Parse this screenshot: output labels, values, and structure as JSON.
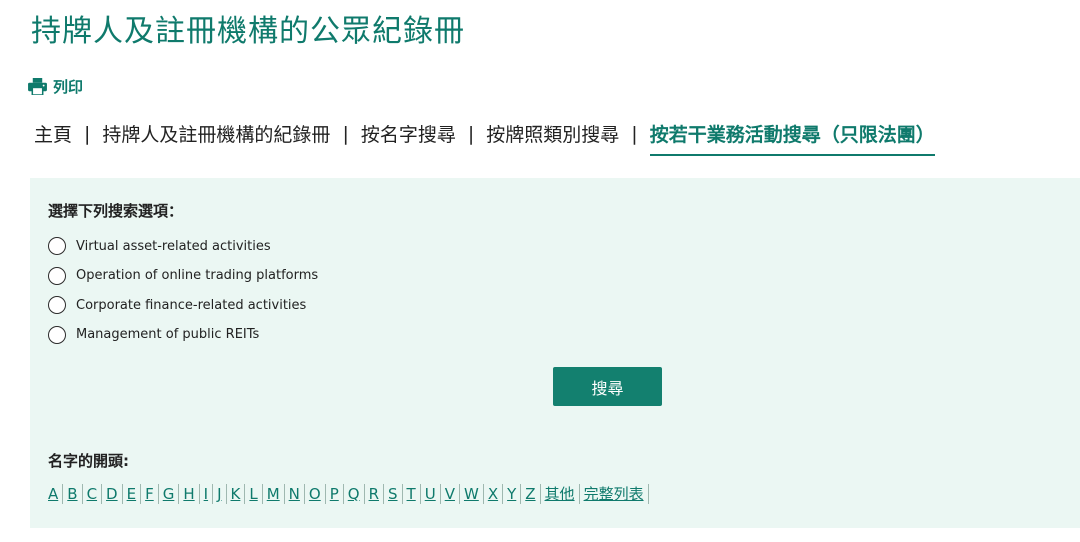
{
  "page": {
    "title": "持牌人及註冊機構的公眾紀錄冊",
    "print_label": "列印"
  },
  "nav": {
    "items": [
      {
        "label": "主頁"
      },
      {
        "label": "持牌人及註冊機構的紀錄冊"
      },
      {
        "label": "按名字搜尋"
      },
      {
        "label": "按牌照類別搜尋"
      },
      {
        "label": "按若干業務活動搜尋（只限法團）"
      }
    ],
    "separator": "|",
    "active_index": 4
  },
  "search": {
    "options_label": "選擇下列搜索選項：",
    "options": [
      {
        "label": "Virtual asset-related activities",
        "selected": false
      },
      {
        "label": "Operation of online trading platforms",
        "selected": false
      },
      {
        "label": "Corporate finance-related activities",
        "selected": false
      },
      {
        "label": "Management of public REITs",
        "selected": false
      }
    ],
    "button_label": "搜尋"
  },
  "names": {
    "label": "名字的開頭:",
    "letters": [
      "A",
      "B",
      "C",
      "D",
      "E",
      "F",
      "G",
      "H",
      "I",
      "J",
      "K",
      "L",
      "M",
      "N",
      "O",
      "P",
      "Q",
      "R",
      "S",
      "T",
      "U",
      "V",
      "W",
      "X",
      "Y",
      "Z",
      "其他",
      "完整列表"
    ]
  },
  "colors": {
    "accent": "#0f7a6c",
    "button": "#13806f",
    "panel_bg": "#ebf7f3"
  }
}
